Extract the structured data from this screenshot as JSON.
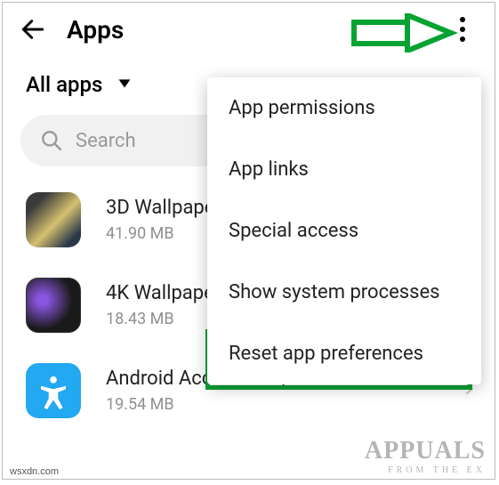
{
  "header": {
    "title": "Apps"
  },
  "filter": {
    "label": "All apps"
  },
  "search": {
    "placeholder": "Search"
  },
  "apps": [
    {
      "name": "3D Wallpape",
      "size": "41.90 MB"
    },
    {
      "name": "4K Wallpape",
      "size": "18.43 MB"
    },
    {
      "name": "Android Accessibility Suite",
      "size": "19.54 MB"
    }
  ],
  "menu": {
    "items": [
      "App permissions",
      "App links",
      "Special access",
      "Show system processes",
      "Reset app preferences"
    ]
  },
  "watermark": {
    "brand": "APPUALS",
    "tagline": "FROM   THE   EX"
  },
  "footer_credit": "wsxdn.com"
}
